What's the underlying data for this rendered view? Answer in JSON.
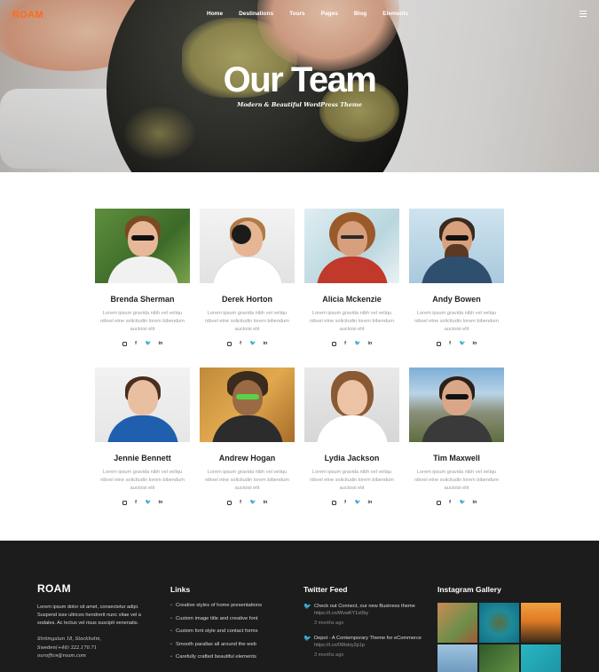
{
  "header": {
    "logo": "ROAM",
    "nav": [
      "Home",
      "Destinations",
      "Tours",
      "Pages",
      "Blog",
      "Elements"
    ],
    "menu_icon": "hamburger-icon"
  },
  "hero": {
    "title": "Our Team",
    "subtitle": "Modern & Beautiful WordPress Theme"
  },
  "team": [
    {
      "name": "Brenda Sherman",
      "desc": "Lorem ipsum gravida nibh vel veliqu nibvel etne solicitudin lorem bibendum auctoisi elit"
    },
    {
      "name": "Derek Horton",
      "desc": "Lorem ipsum gravida nibh vel veliqu nibvel etne solicitudin lorem bibendum auctoisi elit"
    },
    {
      "name": "Alicia Mckenzie",
      "desc": "Lorem ipsum gravida nibh vel veliqu nibvel etne solicitudin lorem bibendum auctoisi elit"
    },
    {
      "name": "Andy Bowen",
      "desc": "Lorem ipsum gravida nibh vel veliqu nibvel etne solicitudin lorem bibendum auctoisi elit"
    },
    {
      "name": "Jennie Bennett",
      "desc": "Lorem ipsum gravida nibh vel veliqu nibvel etne solicitudin lorem bibendum auctoisi elit"
    },
    {
      "name": "Andrew Hogan",
      "desc": "Lorem ipsum gravida nibh vel veliqu nibvel etne solicitudin lorem bibendum auctoisi elit"
    },
    {
      "name": "Lydia Jackson",
      "desc": "Lorem ipsum gravida nibh vel veliqu nibvel etne solicitudin lorem bibendum auctoisi elit"
    },
    {
      "name": "Tim Maxwell",
      "desc": "Lorem ipsum gravida nibh vel veliqu nibvel etne solicitudin lorem bibendum auctoisi elit"
    }
  ],
  "social_icons": [
    "instagram-icon",
    "facebook-icon",
    "twitter-icon",
    "linkedin-icon"
  ],
  "social_glyphs": {
    "facebook": "f",
    "twitter": "🐦",
    "linkedin": "in"
  },
  "footer": {
    "logo": "ROAM",
    "about": "Lorem ipsum dolor sit amet, consectetur adipi. Suspend isse ultrices hendrerit nunc vitae vel a sodales. Ac lectus vel risus suscipit venenatis.",
    "address_lines": [
      "Strömgatan 18, Stockholm,",
      "Sweden(+46) 322.170.71",
      "ourofﬁce@roam.com"
    ],
    "links_title": "Links",
    "links": [
      "Creative styles of home presentations",
      "Custom image title and creative font",
      "Custom font style and contact forms",
      "Smooth parallax all around the web",
      "Carefully crafted beautiful elements"
    ],
    "twitter_title": "Twitter Feed",
    "tweets": [
      {
        "text": "Check out Connect, our new Business theme",
        "url": "https://t.co/WvwKY1o0by",
        "ago": "3 months ago"
      },
      {
        "text": "Depot - A Contemporary Theme for eCommerce",
        "url": "https://t.co/0Wslxy2p1p",
        "ago": "3 months ago"
      }
    ],
    "instagram_title": "Instagram Gallery"
  },
  "colors": {
    "accent": "#ff6a1f",
    "footer_bg": "#1c1c1c"
  }
}
